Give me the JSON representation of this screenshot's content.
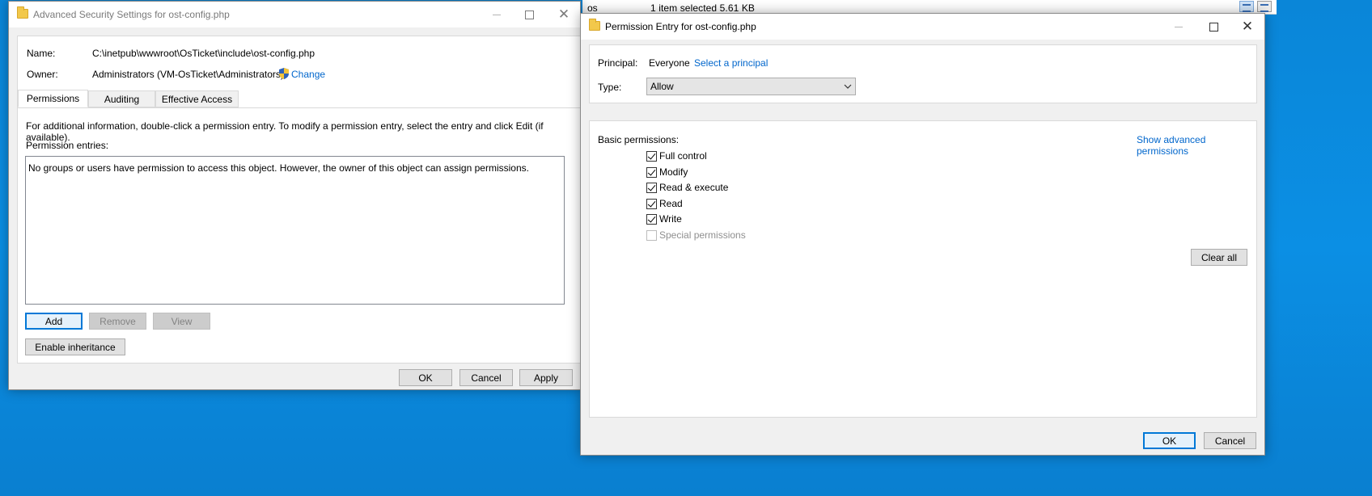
{
  "explorer": {
    "fragment": "os",
    "status": "1 item selected  5.61 KB"
  },
  "adv": {
    "title": "Advanced Security Settings for ost-config.php",
    "name_label": "Name:",
    "name_value": "C:\\inetpub\\wwwroot\\OsTicket\\include\\ost-config.php",
    "owner_label": "Owner:",
    "owner_value": "Administrators (VM-OsTicket\\Administrators)",
    "change_link": "Change",
    "tabs": [
      "Permissions",
      "Auditing",
      "Effective Access"
    ],
    "info_text": "For additional information, double-click a permission entry. To modify a permission entry, select the entry and click Edit (if available).",
    "entries_label": "Permission entries:",
    "empty_message": "No groups or users have permission to access this object. However, the owner of this object can assign permissions.",
    "buttons": {
      "add": "Add",
      "remove": "Remove",
      "view": "View",
      "enable_inheritance": "Enable inheritance",
      "ok": "OK",
      "cancel": "Cancel",
      "apply": "Apply"
    }
  },
  "perm": {
    "title": "Permission Entry for ost-config.php",
    "principal_label": "Principal:",
    "principal_value": "Everyone",
    "select_principal": "Select a principal",
    "type_label": "Type:",
    "type_value": "Allow",
    "basic_label": "Basic permissions:",
    "show_advanced": "Show advanced permissions",
    "permissions": [
      {
        "label": "Full control",
        "checked": true,
        "disabled": false
      },
      {
        "label": "Modify",
        "checked": true,
        "disabled": false
      },
      {
        "label": "Read & execute",
        "checked": true,
        "disabled": false
      },
      {
        "label": "Read",
        "checked": true,
        "disabled": false
      },
      {
        "label": "Write",
        "checked": true,
        "disabled": false
      },
      {
        "label": "Special permissions",
        "checked": false,
        "disabled": true
      }
    ],
    "clear_all": "Clear all",
    "ok": "OK",
    "cancel": "Cancel"
  },
  "colors": {
    "desktop": "#0a86d8",
    "accent": "#0078d7",
    "link": "#0066cc"
  }
}
